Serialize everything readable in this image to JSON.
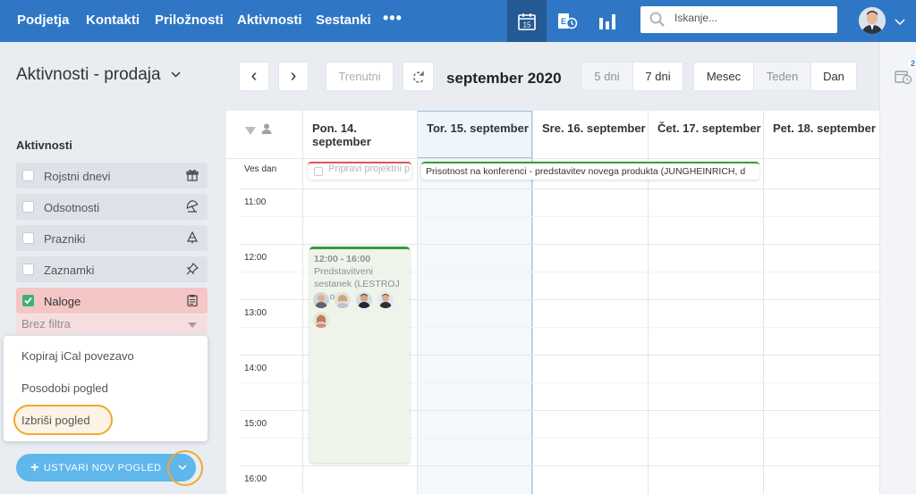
{
  "nav": {
    "items": [
      "Podjetja",
      "Kontakti",
      "Priložnosti",
      "Aktivnosti",
      "Sestanki"
    ],
    "more": "•••",
    "calendar_icon_day": "15",
    "search_placeholder": "Iskanje...",
    "accent_color": "#2f77c5"
  },
  "header": {
    "title": "Aktivnosti - prodaja",
    "prev": "‹",
    "next": "›",
    "today_btn": "Trenutni",
    "month": "september 2020",
    "days5": "5 dni",
    "days7": "7 dni",
    "view_month": "Mesec",
    "view_week": "Teden",
    "view_day": "Dan"
  },
  "right_strip": {
    "badge": "2"
  },
  "sidebar": {
    "heading": "Aktivnosti",
    "filters": [
      {
        "label": "Rojstni dnevi",
        "icon": "gift-icon",
        "checked": false
      },
      {
        "label": "Odsotnosti",
        "icon": "umbrella-icon",
        "checked": false
      },
      {
        "label": "Prazniki",
        "icon": "tree-icon",
        "checked": false
      },
      {
        "label": "Zaznamki",
        "icon": "pin-icon",
        "checked": false
      },
      {
        "label": "Naloge",
        "icon": "clipboard-icon",
        "checked": true
      }
    ],
    "filter_sub": "Brez filtra",
    "dropdown": [
      "Kopiraj iCal povezavo",
      "Posodobi pogled",
      "Izbriši pogled"
    ],
    "create_btn": "USTVARI NOV POGLED"
  },
  "calendar": {
    "days": [
      {
        "line1": "Pon. 14.",
        "line2": "september"
      },
      {
        "line1": "Tor. 15. september",
        "line2": ""
      },
      {
        "line1": "Sre. 16. september",
        "line2": ""
      },
      {
        "line1": "Čet. 17. september",
        "line2": ""
      },
      {
        "line1": "Pet. 18. september",
        "line2": ""
      }
    ],
    "allday": "Ves dan",
    "times": [
      "11:00",
      "12:00",
      "13:00",
      "14:00",
      "15:00",
      "16:00"
    ],
    "events": {
      "task": "Pripravi projektni p",
      "conference": "Prisotnost na konferenci - predstavitev novega produkta (JUNGHEINRICH, d",
      "meeting_time": "12:00 - 16:00",
      "meeting_title": "Predstavitveni sestanek (LESTROJ d.o.o.)"
    }
  }
}
